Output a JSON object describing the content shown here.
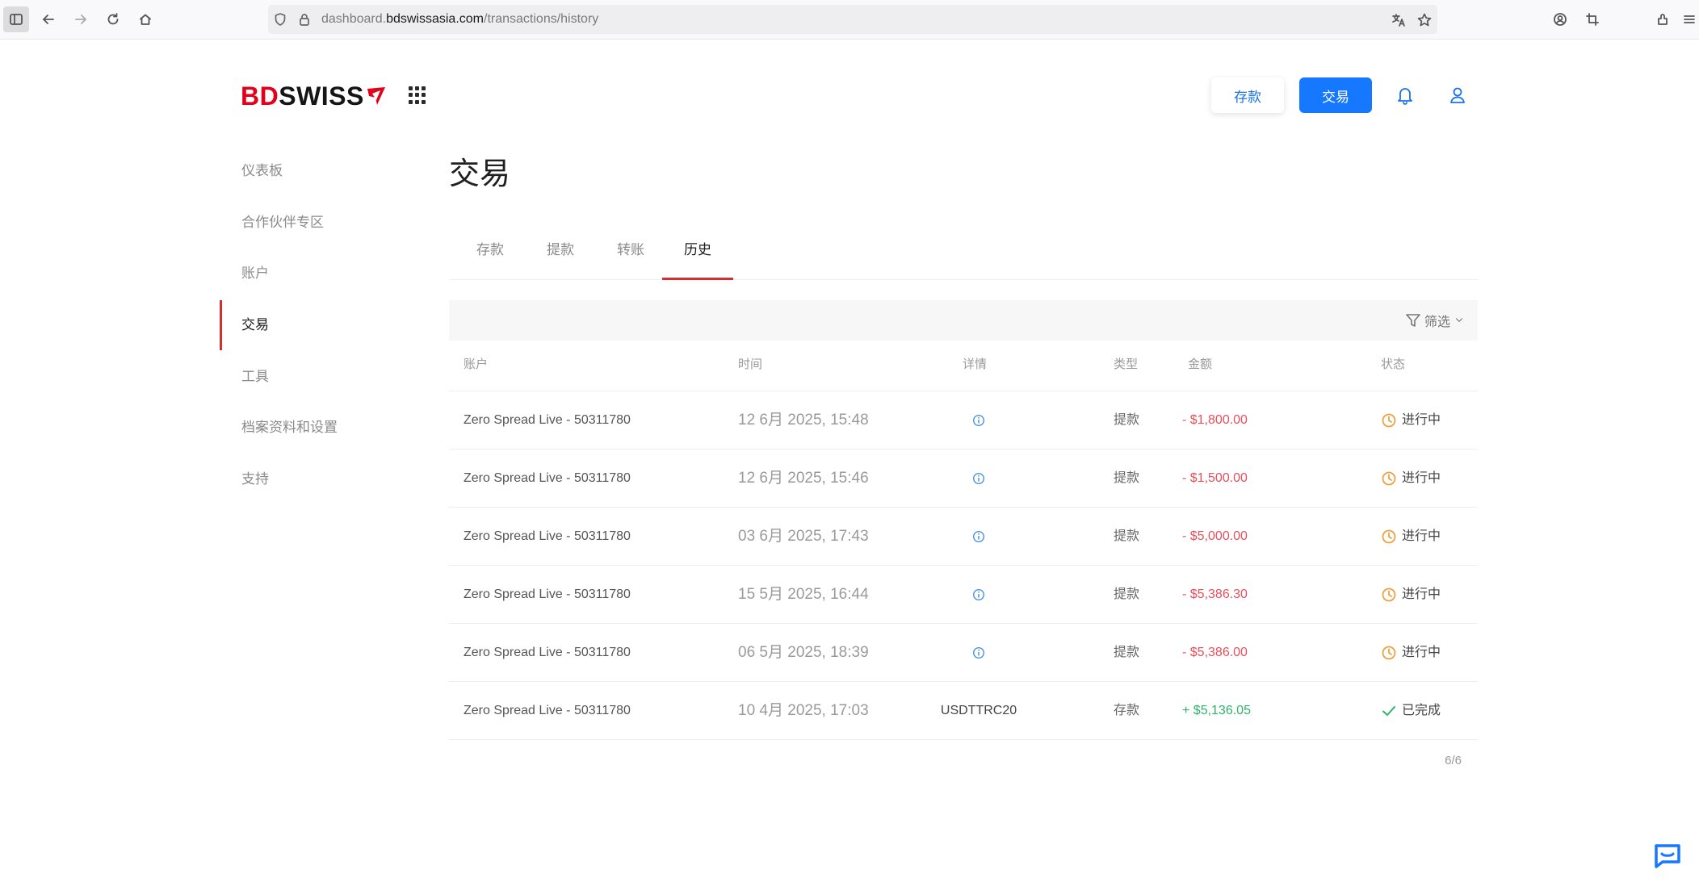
{
  "browser": {
    "url_prefix": "dashboard.",
    "url_domain": "bdswissasia.com",
    "url_path": "/transactions/history"
  },
  "header": {
    "logo_part1": "BD",
    "logo_part2": "SWISS",
    "deposit_label": "存款",
    "trade_label": "交易"
  },
  "sidebar": {
    "items": [
      {
        "label": "仪表板"
      },
      {
        "label": "合作伙伴专区"
      },
      {
        "label": "账户"
      },
      {
        "label": "交易"
      },
      {
        "label": "工具"
      },
      {
        "label": "档案资料和设置"
      },
      {
        "label": "支持"
      }
    ],
    "active_index": 3
  },
  "page": {
    "title": "交易",
    "tabs": [
      {
        "label": "存款"
      },
      {
        "label": "提款"
      },
      {
        "label": "转账"
      },
      {
        "label": "历史"
      }
    ],
    "active_tab": 3,
    "filter_label": "筛选"
  },
  "table": {
    "headers": {
      "account": "账户",
      "time": "时间",
      "detail": "详情",
      "type": "类型",
      "amount": "金额",
      "status": "状态"
    },
    "rows": [
      {
        "account": "Zero Spread Live - 50311780",
        "time": "12 6月 2025, 15:48",
        "detail": "",
        "detail_icon": "info-icon",
        "type": "提款",
        "amount": "- $1,800.00",
        "amount_sign": "negative",
        "status": "进行中",
        "status_icon": "clock-icon"
      },
      {
        "account": "Zero Spread Live - 50311780",
        "time": "12 6月 2025, 15:46",
        "detail": "",
        "detail_icon": "info-icon",
        "type": "提款",
        "amount": "- $1,500.00",
        "amount_sign": "negative",
        "status": "进行中",
        "status_icon": "clock-icon"
      },
      {
        "account": "Zero Spread Live - 50311780",
        "time": "03 6月 2025, 17:43",
        "detail": "",
        "detail_icon": "info-icon",
        "type": "提款",
        "amount": "- $5,000.00",
        "amount_sign": "negative",
        "status": "进行中",
        "status_icon": "clock-icon"
      },
      {
        "account": "Zero Spread Live - 50311780",
        "time": "15 5月 2025, 16:44",
        "detail": "",
        "detail_icon": "info-icon",
        "type": "提款",
        "amount": "- $5,386.30",
        "amount_sign": "negative",
        "status": "进行中",
        "status_icon": "clock-icon"
      },
      {
        "account": "Zero Spread Live - 50311780",
        "time": "06 5月 2025, 18:39",
        "detail": "",
        "detail_icon": "info-icon",
        "type": "提款",
        "amount": "- $5,386.00",
        "amount_sign": "negative",
        "status": "进行中",
        "status_icon": "clock-icon"
      },
      {
        "account": "Zero Spread Live - 50311780",
        "time": "10 4月 2025, 17:03",
        "detail": "USDTTRC20",
        "detail_icon": "",
        "type": "存款",
        "amount": "+ $5,136.05",
        "amount_sign": "positive",
        "status": "已完成",
        "status_icon": "check-icon"
      }
    ],
    "pagination": "6/6"
  },
  "colors": {
    "accent_blue": "#1677ff",
    "brand_red": "#e3001b",
    "negative": "#e8505b",
    "positive": "#2fb36d",
    "pending": "#f0a040"
  }
}
